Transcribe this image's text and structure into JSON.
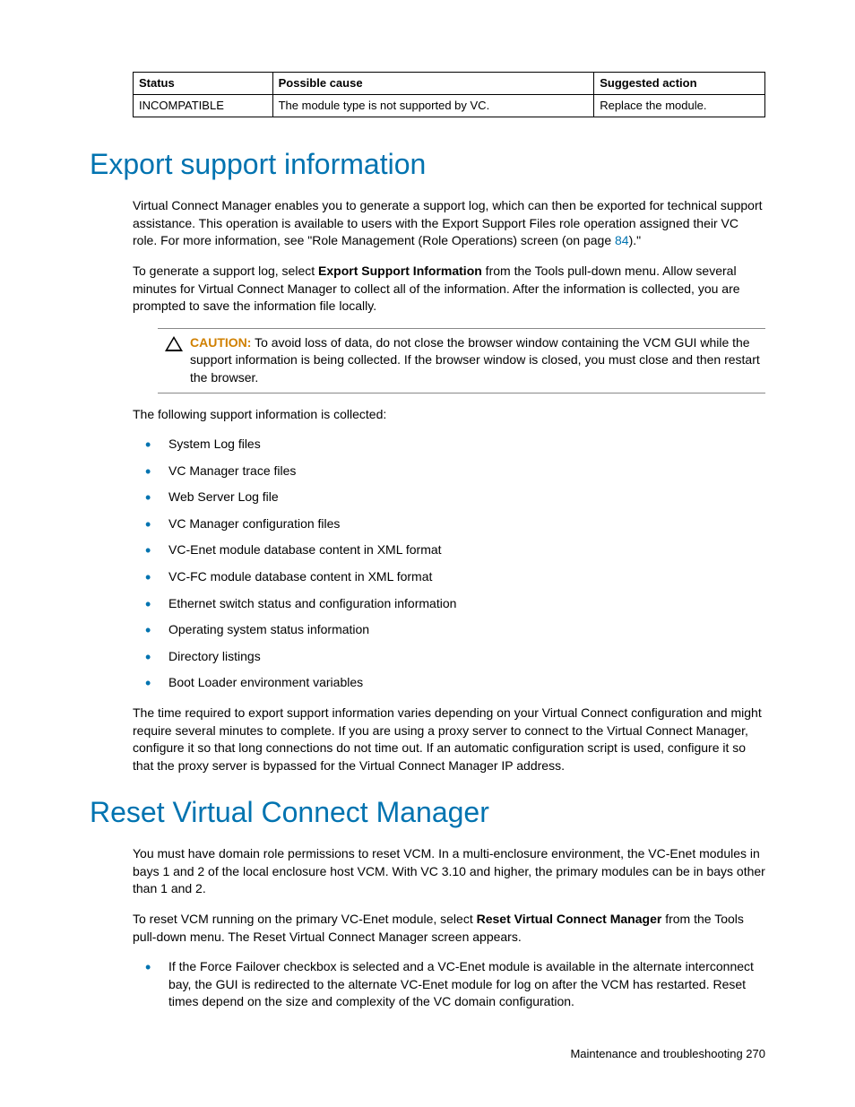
{
  "table": {
    "headers": [
      "Status",
      "Possible cause",
      "Suggested action"
    ],
    "row": [
      "INCOMPATIBLE",
      "The module type is not supported by VC.",
      "Replace the module."
    ]
  },
  "section1": {
    "title": "Export support information",
    "para1_a": "Virtual Connect Manager enables you to generate a support log, which can then be exported for technical support assistance. This operation is available to users with the Export Support Files role operation assigned their VC role. For more information, see \"Role Management (Role Operations) screen (on page ",
    "para1_link": "84",
    "para1_b": ").\"",
    "para2_a": "To generate a support log, select ",
    "para2_bold": "Export Support Information",
    "para2_b": " from the Tools pull-down menu. Allow several minutes for Virtual Connect Manager to collect all of the information. After the information is collected, you are prompted to save the information file locally.",
    "caution_label": "CAUTION:",
    "caution_text": "   To avoid loss of data, do not close the browser window containing the VCM GUI while the support information is being collected. If the browser window is closed, you must close and then restart the browser.",
    "para3": "The following support information is collected:",
    "bullets": [
      "System Log files",
      "VC Manager trace files",
      "Web Server Log file",
      "VC Manager configuration files",
      "VC-Enet module database content in XML format",
      "VC-FC module database content in XML format",
      "Ethernet switch status and configuration information",
      "Operating system status information",
      "Directory listings",
      "Boot Loader environment variables"
    ],
    "para4": "The time required to export support information varies depending on your Virtual Connect configuration and might require several minutes to complete. If you are using a proxy server to connect to the Virtual Connect Manager, configure it so that long connections do not time out. If an automatic configuration script is used, configure it so that the proxy server is bypassed for the Virtual Connect Manager IP address."
  },
  "section2": {
    "title": "Reset Virtual Connect Manager",
    "para1": "You must have domain role permissions to reset VCM. In a multi-enclosure environment, the VC-Enet modules in bays 1 and 2 of the local enclosure host VCM. With VC 3.10 and higher, the primary modules can be in bays other than 1 and 2.",
    "para2_a": "To reset VCM running on the primary VC-Enet module, select ",
    "para2_bold": "Reset Virtual Connect Manager",
    "para2_b": " from the Tools pull-down menu. The Reset Virtual Connect Manager screen appears.",
    "bullet": "If the Force Failover checkbox is selected and a VC-Enet module is available in the alternate interconnect bay, the GUI is redirected to the alternate VC-Enet module for log on after the VCM has restarted. Reset times depend on the size and complexity of the VC domain configuration."
  },
  "footer": {
    "text": "Maintenance and troubleshooting   270"
  }
}
